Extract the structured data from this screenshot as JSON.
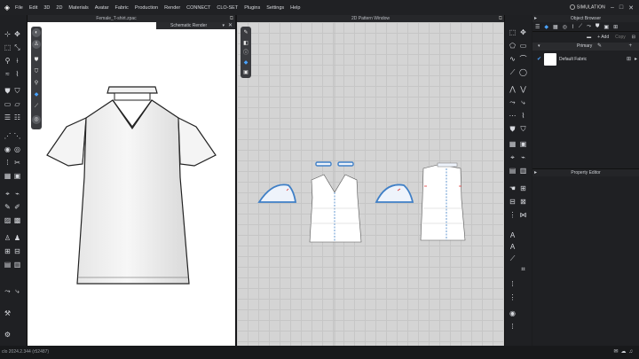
{
  "menubar": {
    "items": [
      "File",
      "Edit",
      "3D",
      "2D",
      "Materials",
      "Avatar",
      "Fabric",
      "Production",
      "Render",
      "CONNECT",
      "CLO-SET",
      "Plugins",
      "Settings",
      "Help"
    ],
    "simulation_label": "SIMULATION"
  },
  "viewport3d": {
    "title": "Female_T-shirt.zpac"
  },
  "schematic": {
    "title": "Schematic Render"
  },
  "viewport2d": {
    "title": "2D Pattern Window"
  },
  "object_browser": {
    "title": "Object Browser",
    "add_label": "+ Add",
    "copy_label": "Copy",
    "primary_label": "Primary",
    "fabric_name": "Default Fabric"
  },
  "property_editor": {
    "title": "Property Editor"
  },
  "status": {
    "text": "clo 2024.2.344 (r52487)"
  },
  "colors": {
    "accent": "#4aa3ff",
    "pattern_outline": "#3f7fc6",
    "grid": "#d4d4d4"
  },
  "icons": [
    "clo-logo-icon",
    "simulation-icon",
    "minimize-icon",
    "maximize-icon",
    "close-icon",
    "pin-icon",
    "edit-icon",
    "check-icon"
  ]
}
